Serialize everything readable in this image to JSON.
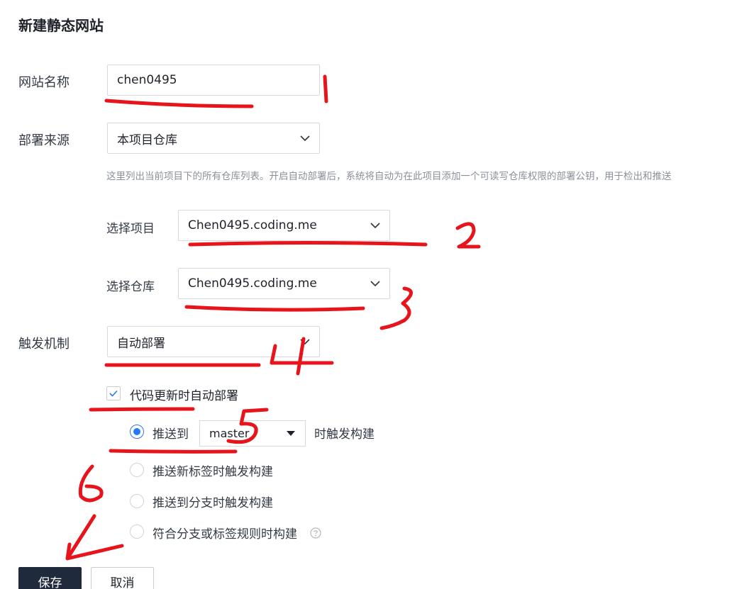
{
  "page": {
    "title": "新建静态网站"
  },
  "site_name": {
    "label": "网站名称",
    "value": "chen0495"
  },
  "deploy_source": {
    "label": "部署来源",
    "value": "本项目仓库",
    "hint": "这里列出当前项目下的所有仓库列表。开启自动部署后，系统将自动为在此项目添加一个可读写仓库权限的部署公钥，用于检出和推送"
  },
  "project": {
    "label": "选择项目",
    "value": "Chen0495.coding.me"
  },
  "repository": {
    "label": "选择仓库",
    "value": "Chen0495.coding.me"
  },
  "trigger": {
    "label": "触发机制",
    "value": "自动部署",
    "auto_deploy_checkbox": {
      "label": "代码更新时自动部署",
      "checked": true
    },
    "options": [
      {
        "prefix": "推送到",
        "branch": "master",
        "suffix": "时触发构建",
        "checked": true
      },
      {
        "label": "推送新标签时触发构建",
        "checked": false
      },
      {
        "label": "推送到分支时触发构建",
        "checked": false
      },
      {
        "label": "符合分支或标签规则时构建",
        "checked": false
      }
    ]
  },
  "actions": {
    "save": "保存",
    "cancel": "取消"
  },
  "annotations": [
    "1",
    "2",
    "3",
    "4",
    "5",
    "6"
  ],
  "colors": {
    "primary_button": "#1f2a3d",
    "radio_accent": "#2878ff",
    "annotation_red": "#e8141c"
  }
}
